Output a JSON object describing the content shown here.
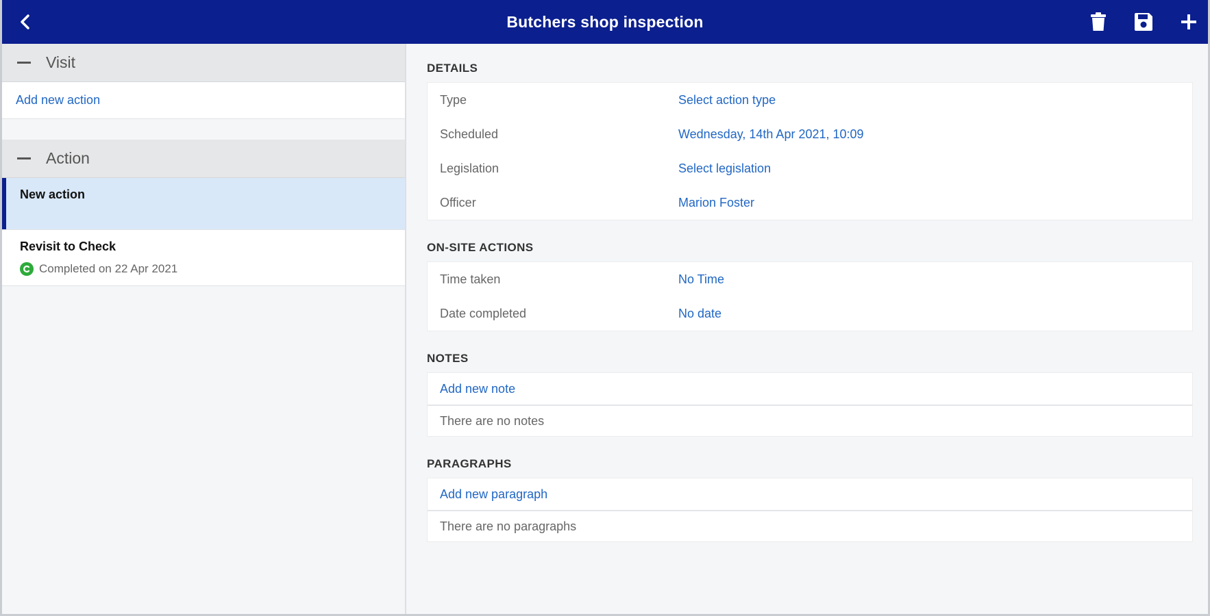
{
  "header": {
    "title": "Butchers shop inspection",
    "icons": {
      "back": "chevron-left-icon",
      "delete": "trash-icon",
      "save": "save-icon",
      "add": "plus-icon"
    },
    "colors": {
      "bar": "#0b1f8f",
      "text": "#ffffff"
    }
  },
  "sidebar": {
    "visit": {
      "label": "Visit",
      "add_action": "Add new action"
    },
    "action": {
      "label": "Action",
      "items": [
        {
          "name": "New action",
          "status": ""
        },
        {
          "name": "Revisit to Check",
          "status": "Completed on 22 Apr 2021",
          "badge": "C"
        }
      ]
    }
  },
  "details": {
    "title": "DETAILS",
    "rows": [
      {
        "key": "Type",
        "value": "Select action type"
      },
      {
        "key": "Scheduled",
        "value": "Wednesday, 14th Apr 2021, 10:09"
      },
      {
        "key": "Legislation",
        "value": "Select legislation"
      },
      {
        "key": "Officer",
        "value": "Marion Foster"
      }
    ]
  },
  "onsite": {
    "title": "ON-SITE ACTIONS",
    "rows": [
      {
        "key": "Time taken",
        "value": "No Time"
      },
      {
        "key": "Date completed",
        "value": "No date"
      }
    ]
  },
  "notes": {
    "title": "NOTES",
    "add": "Add new note",
    "empty": "There are no notes"
  },
  "paragraphs": {
    "title": "PARAGRAPHS",
    "add": "Add new paragraph",
    "empty": "There are no paragraphs"
  }
}
